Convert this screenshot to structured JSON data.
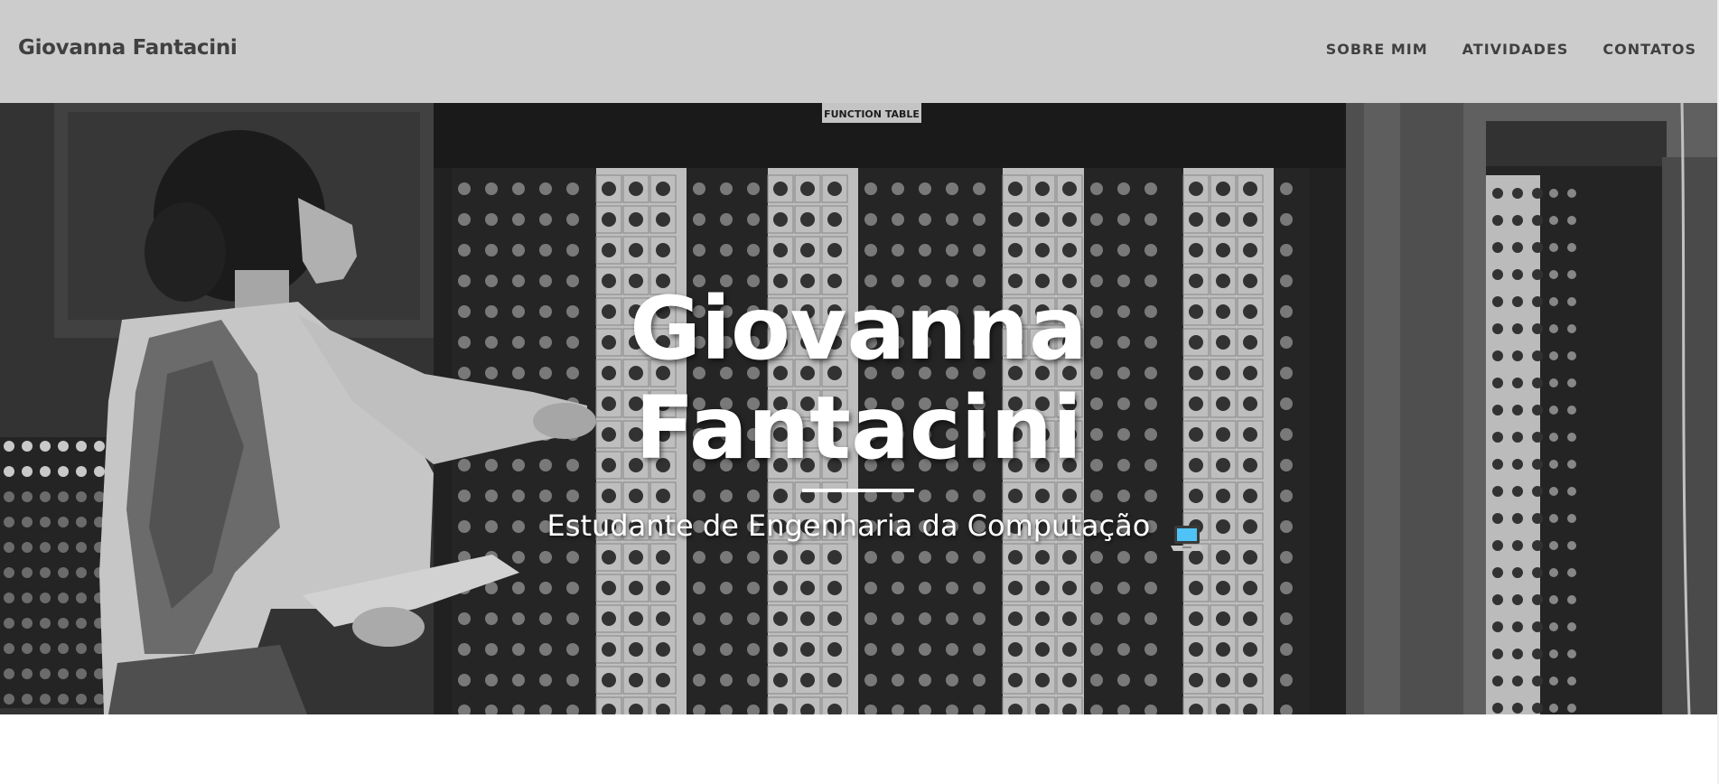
{
  "navbar": {
    "brand": "Giovanna Fantacini",
    "links": [
      {
        "label": "SOBRE MIM"
      },
      {
        "label": "ATIVIDADES"
      },
      {
        "label": "CONTATOS"
      }
    ]
  },
  "hero": {
    "title_line1": "Giovanna",
    "title_line2": "Fantacini",
    "subtitle": "Estudante de Engenharia da Computação",
    "subtitle_icon": "laptop-icon",
    "background_image": "woman-operating-eniac-photo"
  },
  "colors": {
    "navbar_bg": "#cccccc",
    "nav_text": "#404040",
    "hero_text": "#ffffff"
  }
}
